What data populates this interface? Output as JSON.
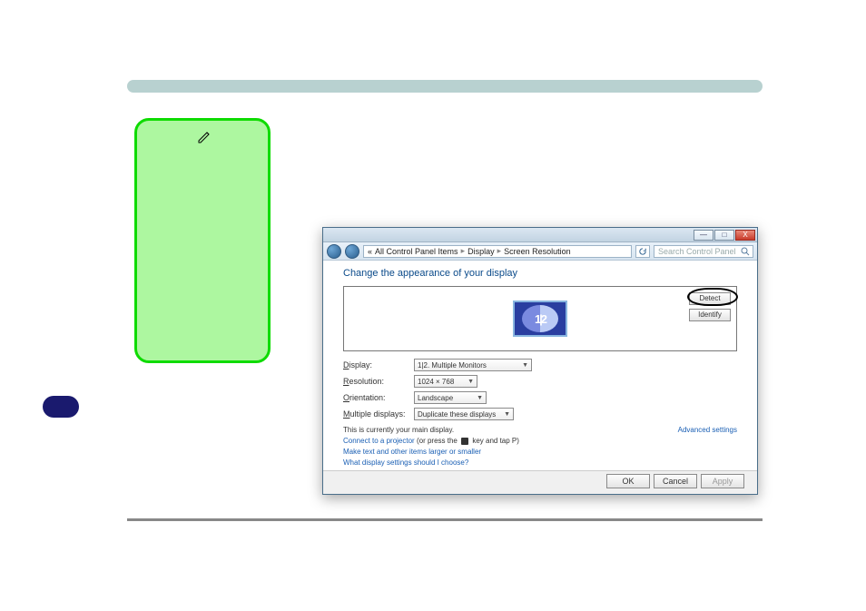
{
  "breadcrumb": {
    "root_glyph": "«",
    "items": [
      "All Control Panel Items",
      "Display",
      "Screen Resolution"
    ]
  },
  "search": {
    "placeholder": "Search Control Panel"
  },
  "title": "Change the appearance of your display",
  "preview": {
    "detect_label": "Detect",
    "identify_label": "Identify",
    "thumb_label": "1|2"
  },
  "fields": {
    "display_label": "Display:",
    "display_value": "1|2. Multiple Monitors",
    "resolution_label": "Resolution:",
    "resolution_value": "1024 × 768",
    "orientation_label": "Orientation:",
    "orientation_value": "Landscape",
    "multiple_label": "Multiple displays:",
    "multiple_value": "Duplicate these displays"
  },
  "main_note": "This is currently your main display.",
  "advanced_label": "Advanced settings",
  "links": {
    "projector_link": "Connect to a projector",
    "projector_hint_a": "(or press the",
    "projector_hint_b": "key and tap P)",
    "textsize": "Make text and other items larger or smaller",
    "which": "What display settings should I choose?"
  },
  "actions": {
    "ok": "OK",
    "cancel": "Cancel",
    "apply": "Apply"
  },
  "titlebar": {
    "min": "—",
    "max": "□",
    "close": "X"
  }
}
